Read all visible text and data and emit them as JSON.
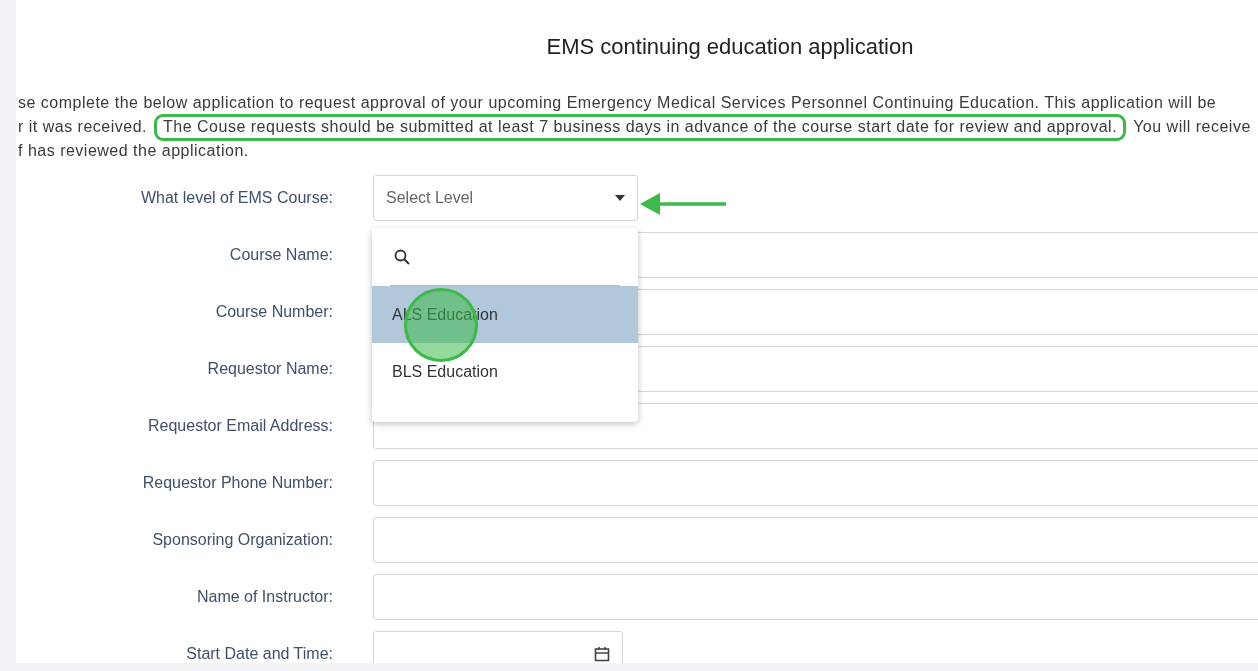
{
  "title": "EMS continuing education application",
  "intro_lines": [
    [
      {
        "text": "se complete the below application to request approval of your upcoming Emergency Medical Services Personnel Continuing Education. This application will be",
        "highlighted": false
      }
    ],
    [
      {
        "text": "r it was received.",
        "highlighted": false
      },
      {
        "text": "The Couse requests should be submitted at least 7 business days in advance of the course start date for review and approval.",
        "highlighted": true
      },
      {
        "text": "You will receive",
        "highlighted": false
      }
    ],
    [
      {
        "text": "f has reviewed the application.",
        "highlighted": false
      }
    ]
  ],
  "fields": [
    {
      "label": "What level of EMS Course:",
      "kind": "select",
      "placeholder": "Select Level"
    },
    {
      "label": "Course Name:",
      "kind": "text"
    },
    {
      "label": "Course Number:",
      "kind": "text"
    },
    {
      "label": "Requestor Name:",
      "kind": "text"
    },
    {
      "label": "Requestor Email Address:",
      "kind": "text"
    },
    {
      "label": "Requestor Phone Number:",
      "kind": "text"
    },
    {
      "label": "Sponsoring Organization:",
      "kind": "text"
    },
    {
      "label": "Name of Instructor:",
      "kind": "text"
    },
    {
      "label": "Start Date and Time:",
      "kind": "date"
    }
  ],
  "dropdown": {
    "options": [
      {
        "label": "ALS Education",
        "selected": true
      },
      {
        "label": "BLS Education",
        "selected": false
      }
    ]
  }
}
